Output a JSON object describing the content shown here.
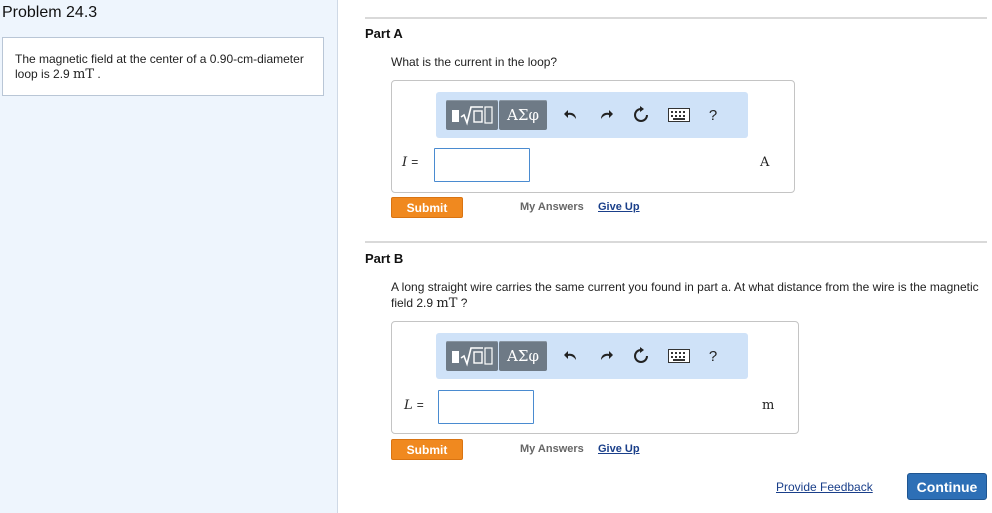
{
  "problem": {
    "title": "Problem 24.3",
    "statement_prefix": "The magnetic field at the center of a 0.90-cm-diameter loop is 2.9",
    "statement_unit": "mT",
    "statement_suffix": "."
  },
  "parts": [
    {
      "title": "Part A",
      "question_prefix": "What is the current in the loop?",
      "question_unit": "",
      "question_suffix": "",
      "variable": "I",
      "equals": "=",
      "input_value": "",
      "unit": "A",
      "toolbar": {
        "greek_label": "ΑΣφ",
        "help_label": "?"
      },
      "submit_label": "Submit",
      "my_answers_label": "My Answers",
      "give_up_label": "Give Up"
    },
    {
      "title": "Part B",
      "question_prefix": "A long straight wire carries the same current you found in part a. At what distance from the wire is the magnetic field 2.9",
      "question_unit": "mT",
      "question_suffix": "?",
      "variable": "L",
      "equals": "=",
      "input_value": "",
      "unit": "m",
      "toolbar": {
        "greek_label": "ΑΣφ",
        "help_label": "?"
      },
      "submit_label": "Submit",
      "my_answers_label": "My Answers",
      "give_up_label": "Give Up"
    }
  ],
  "footer": {
    "feedback_label": "Provide Feedback",
    "continue_label": "Continue"
  },
  "colors": {
    "accent_orange": "#f0891f",
    "continue_blue": "#2d6fb6",
    "link_blue": "#1a3f8a",
    "toolbar_bg": "#cfe2f8"
  }
}
